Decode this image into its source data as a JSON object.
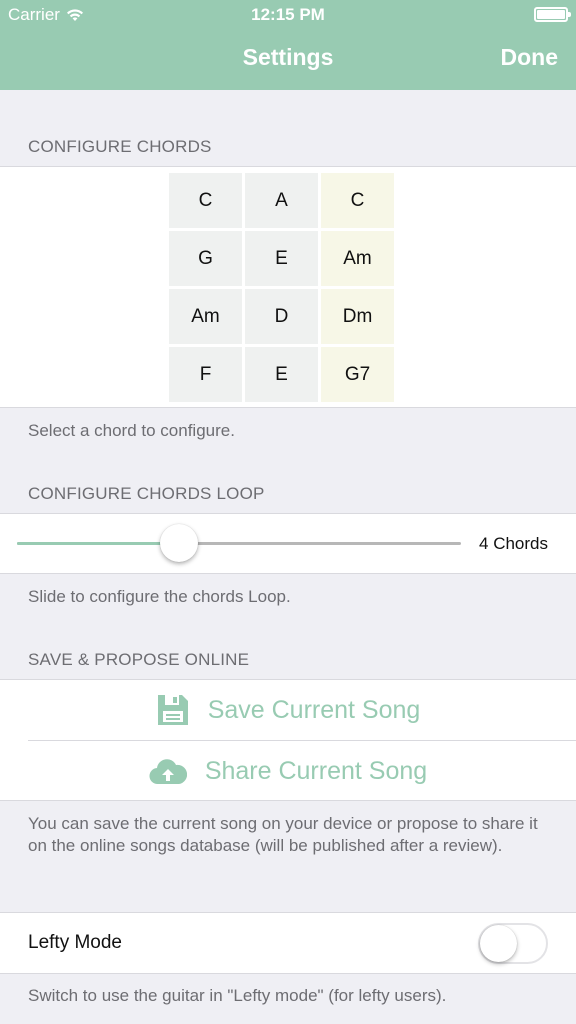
{
  "status_bar": {
    "carrier": "Carrier",
    "time": "12:15 PM"
  },
  "nav": {
    "title": "Settings",
    "done_label": "Done"
  },
  "chords_section": {
    "header": "CONFIGURE CHORDS",
    "footer": "Select a chord to configure.",
    "grid": [
      [
        "C",
        "A",
        "C"
      ],
      [
        "G",
        "E",
        "Am"
      ],
      [
        "Am",
        "D",
        "Dm"
      ],
      [
        "F",
        "E",
        "G7"
      ]
    ]
  },
  "loop_section": {
    "header": "CONFIGURE CHORDS LOOP",
    "value_label": "4 Chords",
    "slider_fraction": 0.365,
    "footer": "Slide to configure the chords Loop."
  },
  "save_section": {
    "header": "SAVE & PROPOSE ONLINE",
    "save_label": "Save Current Song",
    "share_label": "Share Current Song",
    "footer": "You can save the current song on your device or propose to share it on the online songs database (will be published after a review)."
  },
  "lefty_section": {
    "label": "Lefty Mode",
    "enabled": false,
    "footer": "Switch to use the guitar in \"Lefty mode\" (for lefty users)."
  },
  "colors": {
    "accent": "#98cbb2",
    "chord_cell": "#eff1f0",
    "chord_cell_alt": "#f7f7e7"
  }
}
